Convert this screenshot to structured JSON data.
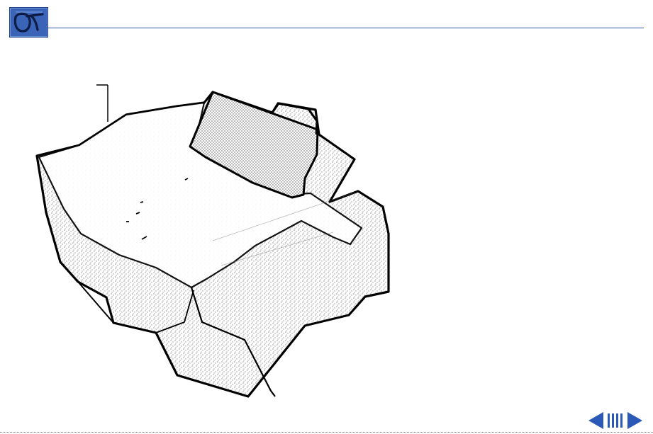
{
  "header": {
    "logo_icon": "manual-logo-icon",
    "accent_color": "#2f5caa"
  },
  "illustration": {
    "icon": "printer-assembly-illustration"
  },
  "navigation": {
    "prev_icon": "arrow-left-icon",
    "index_icon": "page-index-icon",
    "next_icon": "arrow-right-icon",
    "color": "#2a59b7"
  }
}
